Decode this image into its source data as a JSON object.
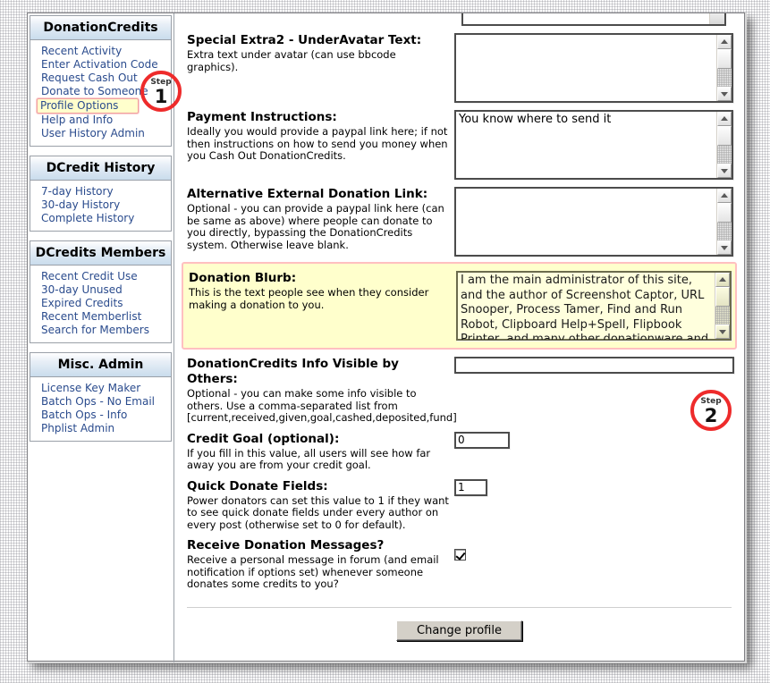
{
  "sidebar": {
    "blocks": [
      {
        "title": "DonationCredits",
        "links": [
          {
            "label": "Recent Activity",
            "highlight": false
          },
          {
            "label": "Enter Activation Code",
            "highlight": false
          },
          {
            "label": "Request Cash Out",
            "highlight": false
          },
          {
            "label": "Donate to Someone",
            "highlight": false
          },
          {
            "label": "Profile Options",
            "highlight": true
          },
          {
            "label": "Help and Info",
            "highlight": false
          },
          {
            "label": "User History Admin",
            "highlight": false
          }
        ]
      },
      {
        "title": "DCredit History",
        "links": [
          {
            "label": "7-day History",
            "highlight": false
          },
          {
            "label": "30-day History",
            "highlight": false
          },
          {
            "label": "Complete History",
            "highlight": false
          }
        ]
      },
      {
        "title": "DCredits Members",
        "links": [
          {
            "label": "Recent Credit Use",
            "highlight": false
          },
          {
            "label": "30-day Unused",
            "highlight": false
          },
          {
            "label": "Expired Credits",
            "highlight": false
          },
          {
            "label": "Recent Memberlist",
            "highlight": false
          },
          {
            "label": "Search for Members",
            "highlight": false
          }
        ]
      },
      {
        "title": "Misc. Admin",
        "links": [
          {
            "label": "License Key Maker",
            "highlight": false
          },
          {
            "label": "Batch Ops - No Email",
            "highlight": false
          },
          {
            "label": "Batch Ops - Info",
            "highlight": false
          },
          {
            "label": "Phplist Admin",
            "highlight": false
          }
        ]
      }
    ]
  },
  "form": {
    "fields": [
      {
        "key": "special_extra2",
        "title": "Special Extra2 - UnderAvatar Text:",
        "desc": "Extra text under avatar (can use bbcode graphics).",
        "value": ""
      },
      {
        "key": "payment_instructions",
        "title": "Payment Instructions:",
        "desc": "Ideally you would provide a paypal link here; if not then instructions on how to send you money when you Cash Out DonationCredits.",
        "value": "You know where to send it"
      },
      {
        "key": "alt_donation_link",
        "title": "Alternative External Donation Link:",
        "desc": "Optional - you can provide a paypal link here (can be same as above) where people can donate to you directly, bypassing the DonationCredits system. Otherwise leave blank.",
        "value": ""
      },
      {
        "key": "donation_blurb",
        "title": "Donation Blurb:",
        "desc": "This is the text people see when they consider making a donation to you.",
        "value": "I am the main administrator of this site, and the author of Screenshot Captor, URL Snooper, Process Tamer, Find and Run Robot, Clipboard Help+Spell, Flipbook Printer, and many other donationware and"
      },
      {
        "key": "info_visible",
        "title": "DonationCredits Info Visible by Others:",
        "desc": "Optional - you can make some info visible to others. Use a comma-separated list from [current,received,given,goal,cashed,deposited,fund]",
        "value": ""
      },
      {
        "key": "credit_goal",
        "title": "Credit Goal (optional):",
        "desc": "If you fill in this value, all users will see how far away you are from your credit goal.",
        "value": "0"
      },
      {
        "key": "quick_donate_fields",
        "title": "Quick Donate Fields:",
        "desc": "Power donators can set this value to 1 if they want to see quick donate fields under every author on every post (otherwise set to 0 for default).",
        "value": "1"
      },
      {
        "key": "receive_messages",
        "title": "Receive Donation Messages?",
        "desc": "Receive a personal message in forum (and email notification if options set) whenever someone donates some credits to you?",
        "value": "checked"
      }
    ],
    "submit_label": "Change profile"
  },
  "annotations": {
    "step1": {
      "label": "Step",
      "number": "1"
    },
    "step2": {
      "label": "Step",
      "number": "2"
    }
  },
  "colors": {
    "accent_red": "#ee2b2b",
    "highlight_yellow": "#ffffcc",
    "highlight_border": "#ffc0c0",
    "link_blue": "#2a4b8d",
    "header_blue": "#c9dcec"
  }
}
